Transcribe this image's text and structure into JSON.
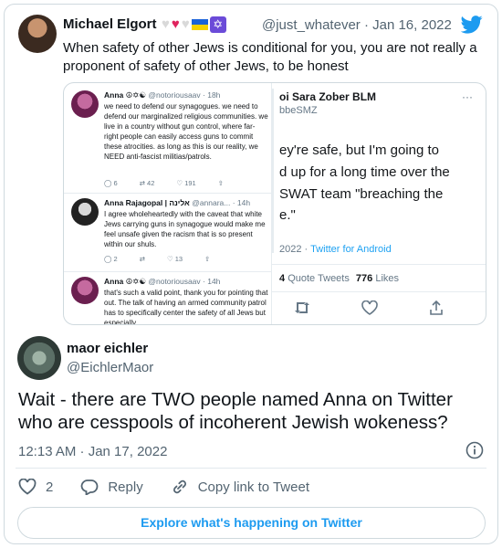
{
  "quote_tweet": {
    "author_name": "Michael Elgort",
    "handle_date": "@just_whatever · Jan 16, 2022",
    "text": "When safety of other Jews is conditional for you, you are not really a proponent of safety of other Jews, to be honest",
    "icons": [
      "white-heart-icon",
      "red-heart-icon",
      "white-heart-icon",
      "ukraine-flag-icon",
      "star-of-david-icon",
      "twitter-bird-icon"
    ],
    "brand_color": "#1d9bf0"
  },
  "embedded_screenshot": {
    "left": {
      "tweets": [
        {
          "name": "Anna ☮︎✡︎☯︎",
          "handle_time": "@notoriousaav · 18h",
          "text": "we need to defend our synagogues. we need to defend our marginalized religious communities. we live in a country without gun control, where far-right people can easily access guns to commit these atrocities. as long as this is our reality, we NEED anti-fascist militias/patrols.",
          "reply_count": "6",
          "retweet_count": "42",
          "like_count": "191"
        },
        {
          "name": "Anna Rajagopal | אלינה",
          "handle_time": "@annara... · 14h",
          "text": "I agree wholeheartedly with the caveat that white Jews carrying guns in synagogue would make me feel unsafe given the racism that is so present within our shuls.",
          "reply_count": "2",
          "retweet_count": "",
          "like_count": "13"
        },
        {
          "name": "Anna ☮︎✡︎☯︎",
          "handle_time": "@notoriousaav · 14h",
          "text": "that's such a valid point, thank you for pointing that out. The talk of having an armed community patrol has to specifically center the safety of all Jews but especially",
          "reply_count": "",
          "retweet_count": "",
          "like_count": ""
        }
      ]
    },
    "right": {
      "name": "oi Sara Zober BLM",
      "handle": "bbeSMZ",
      "lines": [
        "ey're safe, but I'm going to",
        "d up for a long time over the",
        "SWAT team \"breaching the",
        "e.\""
      ],
      "meta_year": "2022",
      "meta_source": "Twitter for Android",
      "quote_count": "4",
      "quote_label": "Quote Tweets",
      "like_count": "776",
      "like_label": "Likes"
    }
  },
  "main_tweet": {
    "author_name": "maor eichler",
    "handle": "@EichlerMaor",
    "text": "Wait - there are TWO people named Anna on Twitter who are cesspools of incoherent Jewish wokeness?",
    "timestamp": "12:13 AM · Jan 17, 2022",
    "like_count": "2",
    "reply_label": "Reply",
    "copy_link_label": "Copy link to Tweet",
    "explore_label": "Explore what's happening on Twitter",
    "accent_color": "#1d9bf0"
  }
}
